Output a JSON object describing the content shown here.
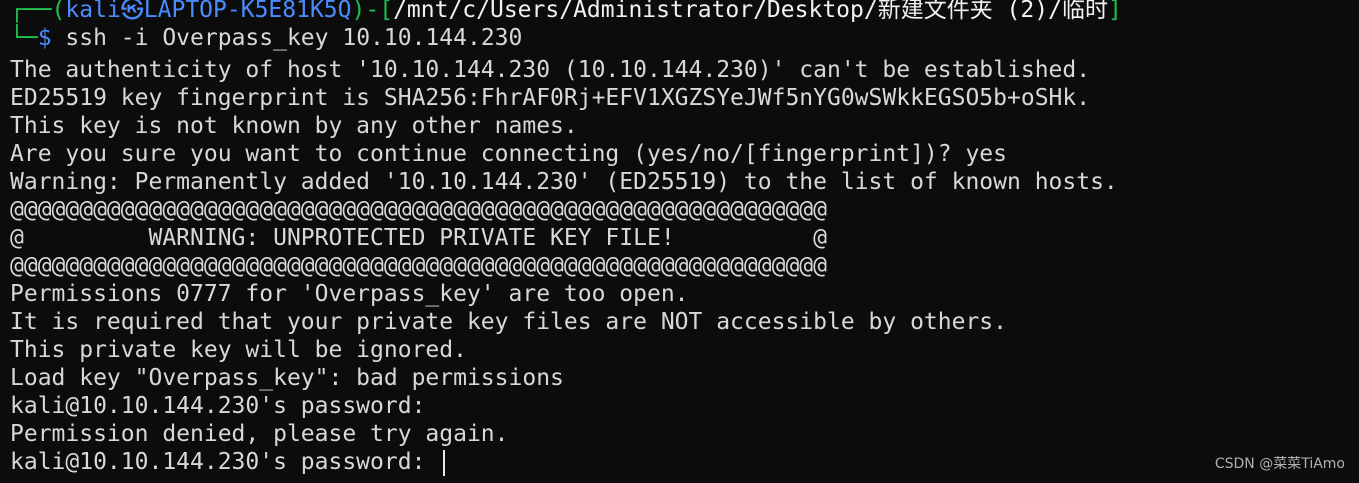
{
  "prompt": {
    "corner_top": "┌──",
    "open_paren": "(",
    "user": "kali",
    "at_symbol": "㉿",
    "host": "LAPTOP-K5E81K5Q",
    "close_dash_bracket": ")-[",
    "path": "/mnt/c/Users/Administrator/Desktop/新建文件夹 (2)/临时",
    "close_bracket": "]",
    "corner_bottom": "└─",
    "dollar": "$",
    "command": " ssh -i Overpass_key 10.10.144.230"
  },
  "output_lines": [
    "The authenticity of host '10.10.144.230 (10.10.144.230)' can't be established.",
    "ED25519 key fingerprint is SHA256:FhrAF0Rj+EFV1XGZSYeJWf5nYG0wSWkkEGSO5b+oSHk.",
    "This key is not known by any other names.",
    "Are you sure you want to continue connecting (yes/no/[fingerprint])? yes",
    "Warning: Permanently added '10.10.144.230' (ED25519) to the list of known hosts.",
    "@@@@@@@@@@@@@@@@@@@@@@@@@@@@@@@@@@@@@@@@@@@@@@@@@@@@@@@@@@@",
    "@         WARNING: UNPROTECTED PRIVATE KEY FILE!          @",
    "@@@@@@@@@@@@@@@@@@@@@@@@@@@@@@@@@@@@@@@@@@@@@@@@@@@@@@@@@@@",
    "Permissions 0777 for 'Overpass_key' are too open.",
    "It is required that your private key files are NOT accessible by others.",
    "This private key will be ignored.",
    "Load key \"Overpass_key\": bad permissions",
    "kali@10.10.144.230's password:",
    "Permission denied, please try again."
  ],
  "last_prompt": "kali@10.10.144.230's password: ",
  "watermark": "CSDN @菜菜TiAmo"
}
